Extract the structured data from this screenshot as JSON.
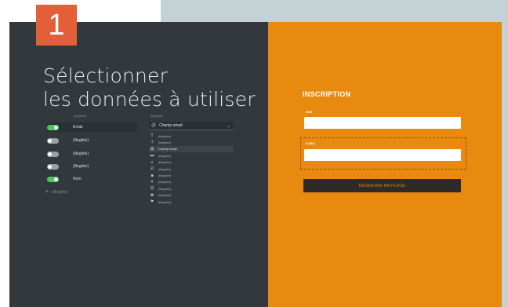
{
  "step": {
    "number": "1"
  },
  "editor": {
    "headline_line1": "Sélectionner",
    "headline_line2": "les données à utiliser",
    "columns": {
      "field_header": "(illegible)",
      "type_header": "(illegible)"
    },
    "fields": [
      {
        "label": "Email",
        "enabled": true,
        "selected": true
      },
      {
        "label": "(illegible)",
        "enabled": false,
        "selected": false
      },
      {
        "label": "(illegible)",
        "enabled": false,
        "selected": false
      },
      {
        "label": "(illegible)",
        "enabled": false,
        "selected": false
      },
      {
        "label": "Nom",
        "enabled": true,
        "selected": false
      }
    ],
    "add_field_label": "(illegible)",
    "type_select": {
      "value": "Champ email",
      "icon": "at-icon"
    },
    "type_options": [
      {
        "label": "(illegible)",
        "icon": "text-icon",
        "active": false
      },
      {
        "label": "(illegible)",
        "icon": "question-icon",
        "active": false
      },
      {
        "label": "Champ email",
        "icon": "at-icon",
        "active": true
      },
      {
        "label": "(illegible)",
        "icon": "comment-icon",
        "active": false
      },
      {
        "label": "(illegible)",
        "icon": "list-icon",
        "active": false
      },
      {
        "label": "(illegible)",
        "icon": "checkbox-icon",
        "active": false
      },
      {
        "label": "(illegible)",
        "icon": "square-icon",
        "active": false
      },
      {
        "label": "(illegible)",
        "icon": "hash-icon",
        "active": false
      },
      {
        "label": "(illegible)",
        "icon": "menu-icon",
        "active": false
      },
      {
        "label": "(illegible)",
        "icon": "gear-icon",
        "active": false
      },
      {
        "label": "(illegible)",
        "icon": "flag-icon",
        "active": false
      }
    ]
  },
  "form": {
    "title": "INSCRIPTION",
    "name_label": "NOM",
    "name_value": "",
    "email_label": "E-MAIL",
    "email_value": "",
    "submit_label": "RÉSERVER MA PLACE"
  },
  "colors": {
    "dark_panel": "#33383d",
    "orange_panel": "#e88a0f",
    "step_badge": "#e25f3a",
    "toggle_on": "#4cc85a",
    "button": "#2e2a27"
  }
}
